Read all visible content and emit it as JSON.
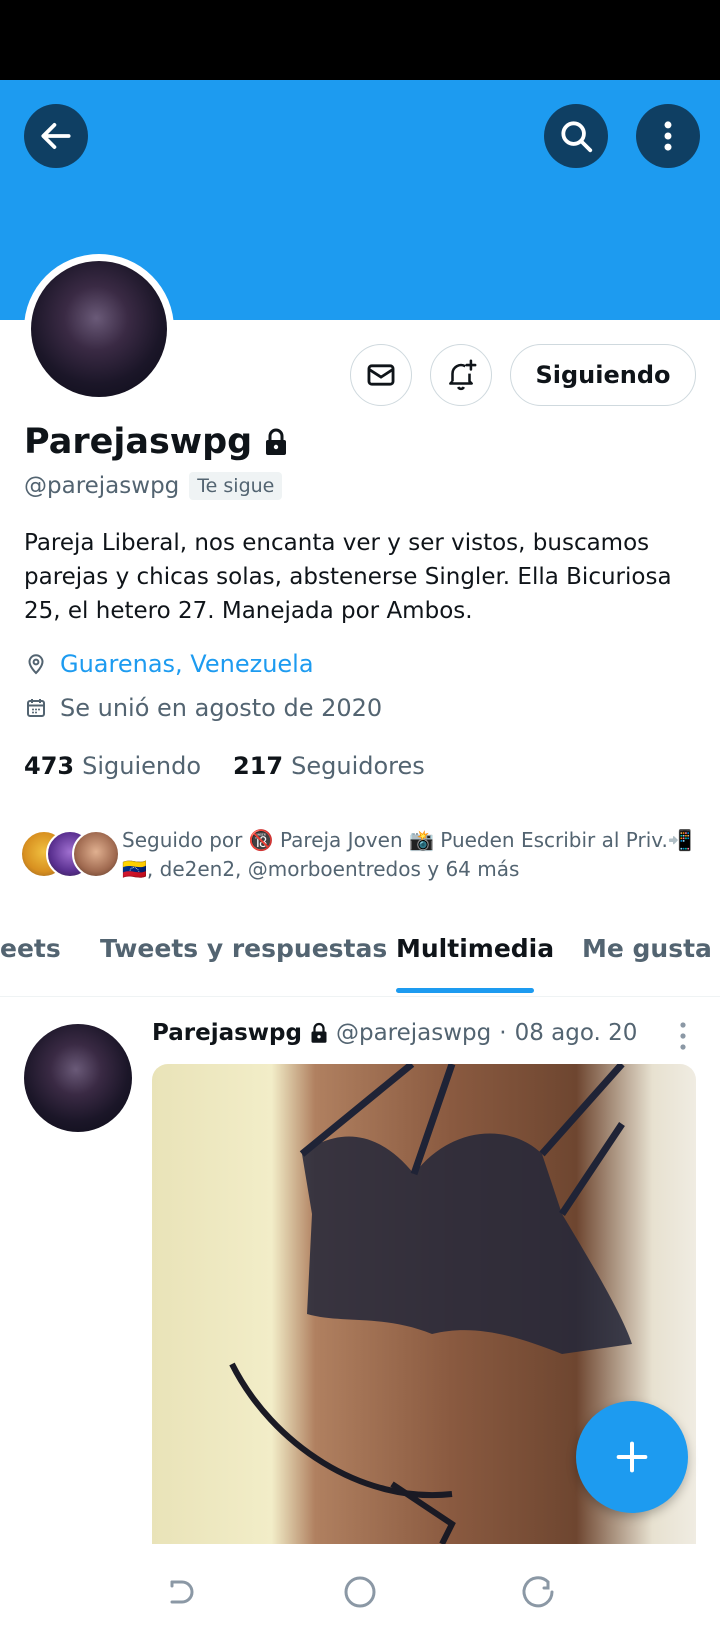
{
  "profile": {
    "name": "Parejaswpg",
    "handle": "@parejaswpg",
    "follows_you": "Te sigue",
    "bio": "Pareja Liberal, nos encanta ver y ser vistos, buscamos parejas y chicas solas, abstenerse Singler. Ella Bicuriosa 25, el hetero 27. Manejada por Ambos.",
    "location": "Guarenas, Venezuela",
    "joined": "Se unió en agosto de 2020",
    "following_count": "473",
    "following_label": "Siguiendo",
    "followers_count": "217",
    "followers_label": "Seguidores",
    "followed_by_line1": "Seguido por 🔞 Pareja Joven 📸 Pueden Escribir al Priv.📲",
    "followed_by_line2": "🇻🇪, de2en2, @morboentredos y 64 más"
  },
  "actions": {
    "follow_button": "Siguiendo"
  },
  "tabs": [
    {
      "label": "eets"
    },
    {
      "label": "Tweets y respuestas"
    },
    {
      "label": "Multimedia"
    },
    {
      "label": "Me gusta"
    }
  ],
  "tweet": {
    "name": "Parejaswpg",
    "handle": "@parejaswpg",
    "separator": "·",
    "date": "08 ago. 20"
  },
  "colors": {
    "accent": "#1d9bf0",
    "banner": "#1d9bf0",
    "header_button": "#0f3f63",
    "text_secondary": "#536471"
  },
  "icons": [
    "back-arrow-icon",
    "search-icon",
    "more-vertical-icon",
    "mail-icon",
    "bell-plus-icon",
    "lock-icon",
    "location-pin-icon",
    "calendar-icon",
    "more-icon",
    "plus-icon",
    "nav-back-icon",
    "nav-home-icon",
    "nav-recents-icon"
  ]
}
